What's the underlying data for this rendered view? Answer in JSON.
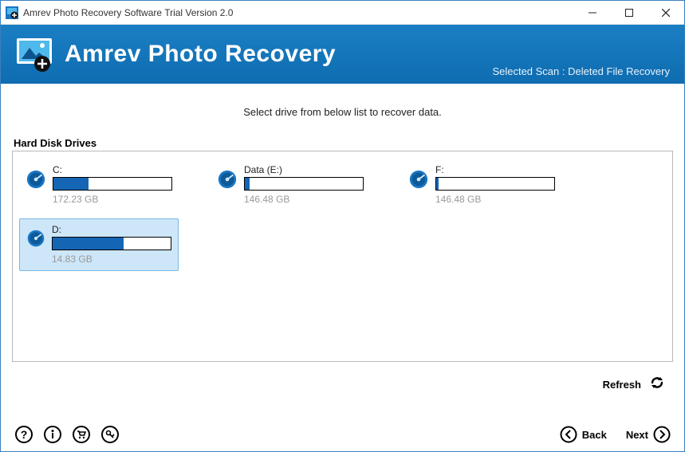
{
  "window": {
    "title": "Amrev Photo Recovery Software Trial Version 2.0"
  },
  "header": {
    "title": "Amrev Photo Recovery",
    "scan_label": "Selected Scan : Deleted File Recovery"
  },
  "instruction": "Select drive from below list to recover data.",
  "panel": {
    "title": "Hard Disk Drives"
  },
  "drives": [
    {
      "label": "C:",
      "size": "172.23 GB",
      "fill_pct": 30,
      "selected": false
    },
    {
      "label": "Data (E:)",
      "size": "146.48 GB",
      "fill_pct": 4,
      "selected": false
    },
    {
      "label": "F:",
      "size": "146.48 GB",
      "fill_pct": 2,
      "selected": false
    },
    {
      "label": "D:",
      "size": "14.83 GB",
      "fill_pct": 60,
      "selected": true
    }
  ],
  "actions": {
    "refresh": "Refresh",
    "back": "Back",
    "next": "Next"
  }
}
